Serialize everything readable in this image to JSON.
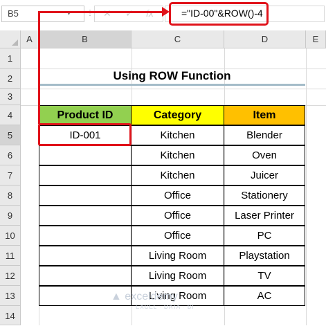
{
  "formula_bar": {
    "name_box": "B5",
    "formula": "=\"ID-00\"&ROW()-4",
    "icons": {
      "dots": "vertical-dots-icon",
      "cancel": "x-icon",
      "enter": "check-icon",
      "fx": "fx-icon"
    }
  },
  "columns": [
    "A",
    "B",
    "C",
    "D",
    "E"
  ],
  "rows": [
    "1",
    "2",
    "3",
    "4",
    "5",
    "6",
    "7",
    "8",
    "9",
    "10",
    "11",
    "12",
    "13",
    "14"
  ],
  "title": "Using ROW Function",
  "table": {
    "headers": [
      "Product ID",
      "Category",
      "Item"
    ],
    "header_colors": [
      "#92d050",
      "#ffff00",
      "#ffc000"
    ],
    "rows": [
      [
        "ID-001",
        "Kitchen",
        "Blender"
      ],
      [
        "",
        "Kitchen",
        "Oven"
      ],
      [
        "",
        "Kitchen",
        "Juicer"
      ],
      [
        "",
        "Office",
        "Stationery"
      ],
      [
        "",
        "Office",
        "Laser Printer"
      ],
      [
        "",
        "Office",
        "PC"
      ],
      [
        "",
        "Living Room",
        "Playstation"
      ],
      [
        "",
        "Living Room",
        "TV"
      ],
      [
        "",
        "Living Room",
        "AC"
      ]
    ]
  },
  "watermark": {
    "brand": "exceldemy",
    "tagline": "EXCEL · DATA · BI"
  },
  "accent": "#e0121a"
}
